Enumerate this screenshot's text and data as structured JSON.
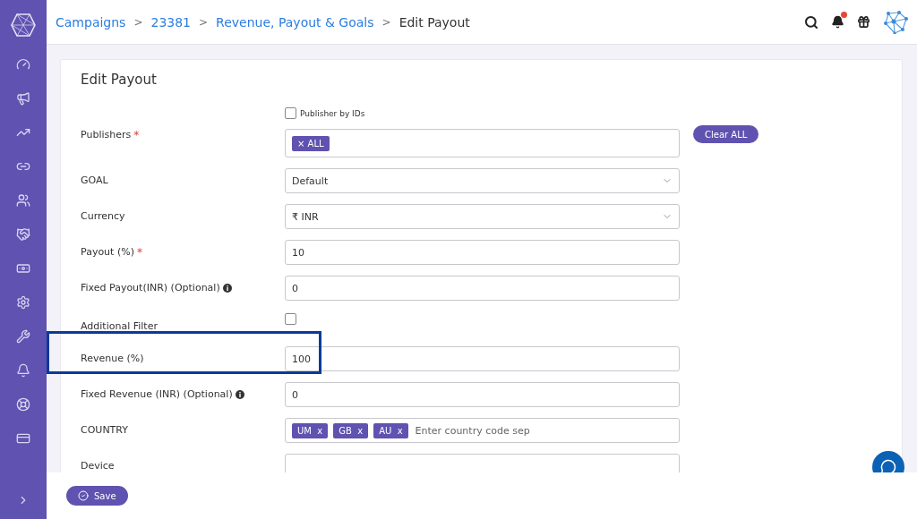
{
  "breadcrumbs": {
    "separator": ">",
    "items": [
      {
        "label": "Campaigns",
        "kind": "link"
      },
      {
        "label": "23381",
        "kind": "link"
      },
      {
        "label": "Revenue, Payout & Goals",
        "kind": "link"
      },
      {
        "label": "Edit Payout",
        "kind": "current"
      }
    ]
  },
  "header": {
    "notification_badge": true
  },
  "card": {
    "title": "Edit Payout"
  },
  "fields": [
    {
      "kind": "tags",
      "label": "Publishers",
      "marker": "*",
      "option": {
        "label": "Publisher by IDs",
        "checked": false
      },
      "tags": [
        {
          "label": "ALL",
          "remove": "×"
        }
      ],
      "action": "Clear ALL"
    },
    {
      "kind": "select",
      "label": "GOAL",
      "value": "Default"
    },
    {
      "kind": "select",
      "label": "Currency",
      "value": "₹ INR"
    },
    {
      "kind": "input",
      "label": "Payout (%)",
      "marker": "*",
      "value": "10"
    },
    {
      "kind": "input",
      "label": "Fixed Payout(INR) (Optional)",
      "info": true,
      "value": "0"
    },
    {
      "kind": "checkbox",
      "label": "Additional Filter",
      "checked": false
    },
    {
      "kind": "input",
      "label": "Revenue (%)",
      "value": "100",
      "highlighted": true
    },
    {
      "kind": "input",
      "label": "Fixed Revenue (INR) (Optional)",
      "info": true,
      "value": "0"
    },
    {
      "kind": "tag-input",
      "label": "COUNTRY",
      "tags": [
        {
          "label": "UM",
          "remove": "x"
        },
        {
          "label": "GB",
          "remove": "x"
        },
        {
          "label": "AU",
          "remove": "x"
        }
      ],
      "placeholder": "Enter country code sep"
    },
    {
      "kind": "input",
      "label": "Device"
    }
  ],
  "footer": {
    "save": "Save"
  }
}
